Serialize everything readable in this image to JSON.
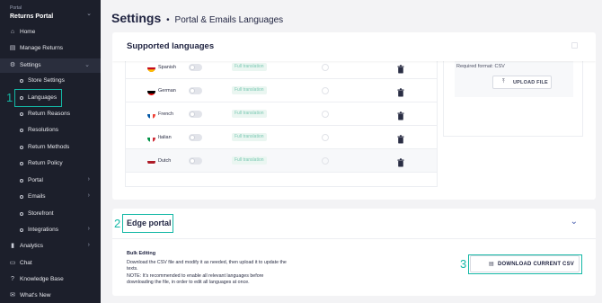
{
  "sidebar": {
    "portal_small": "Portal",
    "portal_name": "Returns Portal",
    "items": [
      {
        "label": "Home",
        "icon": "home-icon"
      },
      {
        "label": "Manage Returns",
        "icon": "inbox-icon"
      },
      {
        "label": "Settings",
        "icon": "gear-icon"
      }
    ],
    "settings_sub": [
      {
        "label": "Store Settings"
      },
      {
        "label": "Languages"
      },
      {
        "label": "Return Reasons"
      },
      {
        "label": "Resolutions"
      },
      {
        "label": "Return Methods"
      },
      {
        "label": "Return Policy"
      },
      {
        "label": "Portal"
      },
      {
        "label": "Emails"
      },
      {
        "label": "Storefront"
      },
      {
        "label": "Integrations"
      }
    ],
    "bottom": [
      {
        "label": "Analytics",
        "icon": "chart-icon"
      },
      {
        "label": "Chat",
        "icon": "chat-icon"
      },
      {
        "label": "Knowledge Base",
        "icon": "help-icon"
      },
      {
        "label": "What's New",
        "icon": "news-icon"
      }
    ]
  },
  "header": {
    "title": "Settings",
    "separator": "•",
    "subtitle": "Portal & Emails Languages"
  },
  "supported": {
    "title": "Supported languages",
    "languages": [
      {
        "name": "Spanish",
        "status": "Full translation"
      },
      {
        "name": "German",
        "status": "Full translation"
      },
      {
        "name": "French",
        "status": "Full translation"
      },
      {
        "name": "Italian",
        "status": "Full translation"
      },
      {
        "name": "Dutch",
        "status": "Full translation"
      }
    ],
    "format_label": "Required format: CSV",
    "upload_label": "UPLOAD FILE"
  },
  "edge": {
    "title": "Edge portal",
    "bulk_title": "Bulk Editing",
    "desc1": "Download the CSV file and modify it as needed, then upload it to update the texts.",
    "desc2": "NOTE: It's recommended to enable all relevant languages before downloading the file, in order to edit all languages at once.",
    "download_label": "DOWNLOAD CURRENT CSV"
  },
  "annotations": {
    "m1": "1",
    "m2": "2",
    "m3": "3"
  },
  "colors": {
    "sidebar_bg": "#1c1f2b",
    "highlight": "#14b8a6",
    "badge_text": "#7cc9b4"
  }
}
